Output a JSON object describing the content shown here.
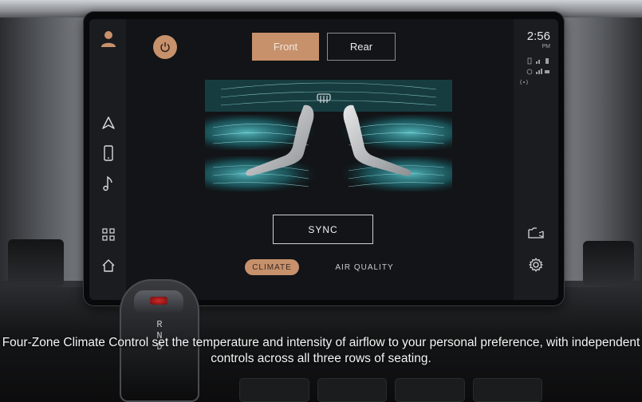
{
  "header": {
    "tabs": [
      {
        "label": "Front",
        "active": true
      },
      {
        "label": "Rear",
        "active": false
      }
    ]
  },
  "status": {
    "time": "2:56",
    "ampm": "PM"
  },
  "sidebar_left": {
    "icons": [
      "navigation-icon",
      "phone-icon",
      "music-icon",
      "apps-grid-icon",
      "home-icon"
    ]
  },
  "sidebar_right": {
    "icons": [
      "camera-icon",
      "settings-icon"
    ]
  },
  "climate": {
    "sync_label": "SYNC",
    "defrost_icon": "rear-defrost-icon"
  },
  "bottom_tabs": [
    {
      "label": "CLIMATE",
      "active": true
    },
    {
      "label": "AIR QUALITY",
      "active": false
    }
  ],
  "gear_selector": {
    "letters": [
      "R",
      "N",
      "D"
    ]
  },
  "caption": "Four-Zone Climate Control set the temperature and intensity of airflow to your personal preference, with independent controls across all three rows of seating.",
  "colors": {
    "accent": "#c7916c",
    "screen_bg": "#121417",
    "airflow_teal": "#3fb6bd"
  }
}
